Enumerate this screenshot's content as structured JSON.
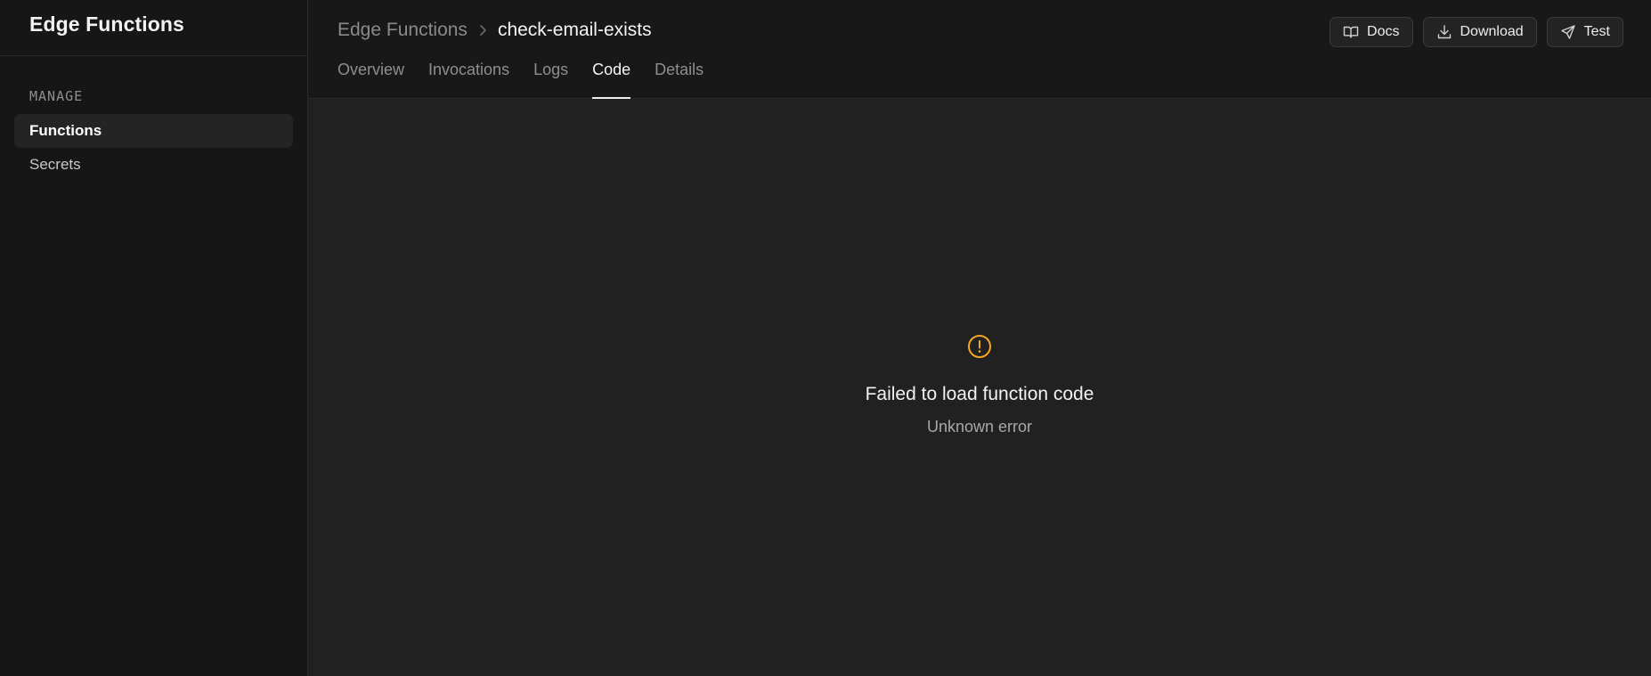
{
  "sidebar": {
    "title": "Edge Functions",
    "section_label": "MANAGE",
    "items": [
      {
        "label": "Functions",
        "active": true
      },
      {
        "label": "Secrets",
        "active": false
      }
    ]
  },
  "header": {
    "breadcrumb_root": "Edge Functions",
    "breadcrumb_current": "check-email-exists",
    "buttons": {
      "docs": "Docs",
      "download": "Download",
      "test": "Test"
    },
    "tabs": [
      {
        "label": "Overview",
        "active": false
      },
      {
        "label": "Invocations",
        "active": false
      },
      {
        "label": "Logs",
        "active": false
      },
      {
        "label": "Code",
        "active": true
      },
      {
        "label": "Details",
        "active": false
      }
    ]
  },
  "main": {
    "error_title": "Failed to load function code",
    "error_message": "Unknown error",
    "icon": "warning-circle-icon",
    "warning_color": "#f5a623"
  }
}
